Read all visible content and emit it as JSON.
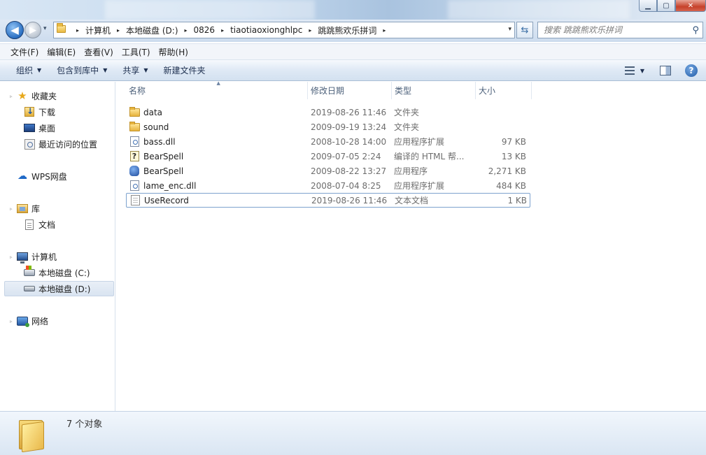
{
  "window": {
    "minimize_glyph": "▁",
    "maximize_glyph": "▢",
    "close_glyph": "✕"
  },
  "address": {
    "breadcrumbs": [
      "计算机",
      "本地磁盘 (D:)",
      "0826",
      "tiaotiaoxionghlpc",
      "跳跳熊欢乐拼词"
    ],
    "separator_glyph": "▸",
    "dropdown_glyph": "▾",
    "refresh_glyph": "⇆",
    "back_glyph": "◀",
    "forward_glyph": "▶",
    "recent_glyph": "▾"
  },
  "search": {
    "placeholder": "搜索 跳跳熊欢乐拼词",
    "icon": "search-icon",
    "icon_glyph": "⚲"
  },
  "menu": {
    "items": [
      "文件(F)",
      "编辑(E)",
      "查看(V)",
      "工具(T)",
      "帮助(H)"
    ]
  },
  "toolbar": {
    "organize": "组织",
    "include_in_library": "包含到库中",
    "share": "共享",
    "new_folder": "新建文件夹",
    "caret_glyph": "▼",
    "help_glyph": "?"
  },
  "nav": {
    "favorites": "收藏夹",
    "downloads": "下载",
    "desktop": "桌面",
    "recent": "最近访问的位置",
    "wps": "WPS网盘",
    "libraries": "库",
    "documents": "文档",
    "computer": "计算机",
    "drive_c": "本地磁盘 (C:)",
    "drive_d": "本地磁盘 (D:)",
    "network": "网络",
    "star_glyph": "★",
    "cloud_glyph": "☁",
    "expand_glyph": "▹"
  },
  "columns": {
    "name": "名称",
    "date": "修改日期",
    "type": "类型",
    "size": "大小",
    "sort_glyph": "▲"
  },
  "files": [
    {
      "name": "data",
      "date": "2019-08-26 11:46",
      "type": "文件夹",
      "size": "",
      "icon": "folder-icon"
    },
    {
      "name": "sound",
      "date": "2009-09-19 13:24",
      "type": "文件夹",
      "size": "",
      "icon": "folder-icon"
    },
    {
      "name": "bass.dll",
      "date": "2008-10-28 14:00",
      "type": "应用程序扩展",
      "size": "97 KB",
      "icon": "dll-icon"
    },
    {
      "name": "BearSpell",
      "date": "2009-07-05 2:24",
      "type": "编译的 HTML 帮...",
      "size": "13 KB",
      "icon": "help-file-icon"
    },
    {
      "name": "BearSpell",
      "date": "2009-08-22 13:27",
      "type": "应用程序",
      "size": "2,271 KB",
      "icon": "exe-icon"
    },
    {
      "name": "lame_enc.dll",
      "date": "2008-07-04 8:25",
      "type": "应用程序扩展",
      "size": "484 KB",
      "icon": "dll-icon"
    },
    {
      "name": "UseRecord",
      "date": "2019-08-26 11:46",
      "type": "文本文档",
      "size": "1 KB",
      "icon": "text-file-icon"
    }
  ],
  "status": {
    "count": "7 个对象"
  },
  "help_file_glyph": "?"
}
